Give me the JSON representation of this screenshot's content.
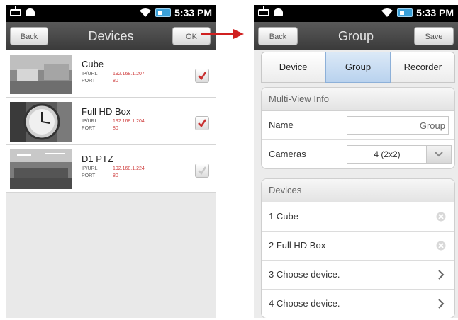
{
  "status_bar": {
    "time": "5:33 PM"
  },
  "left_screen": {
    "title": "Devices",
    "back_label": "Back",
    "ok_label": "OK",
    "devices": [
      {
        "name": "Cube",
        "ip_label": "IP/URL",
        "ip": "192.168.1.207",
        "port_label": "PORT",
        "port": "80",
        "checked": true
      },
      {
        "name": "Full HD Box",
        "ip_label": "IP/URL",
        "ip": "192.168.1.204",
        "port_label": "PORT",
        "port": "80",
        "checked": true
      },
      {
        "name": "D1 PTZ",
        "ip_label": "IP/URL",
        "ip": "192.168.1.224",
        "port_label": "PORT",
        "port": "80",
        "checked": false
      }
    ]
  },
  "right_screen": {
    "title": "Group",
    "back_label": "Back",
    "save_label": "Save",
    "tabs": [
      {
        "label": "Device",
        "active": false
      },
      {
        "label": "Group",
        "active": true
      },
      {
        "label": "Recorder",
        "active": false
      }
    ],
    "multi_view": {
      "header": "Multi-View Info",
      "name_label": "Name",
      "name_value": "Group",
      "cameras_label": "Cameras",
      "cameras_value": "4 (2x2)"
    },
    "devices_section": {
      "header": "Devices",
      "items": [
        {
          "label": "1  Cube",
          "action": "remove-icon"
        },
        {
          "label": "2  Full HD Box",
          "action": "remove-icon"
        },
        {
          "label": "3  Choose device.",
          "action": "chevron-right-icon"
        },
        {
          "label": "4  Choose device.",
          "action": "chevron-right-icon"
        }
      ]
    }
  },
  "colors": {
    "accent_red": "#d02020",
    "check_red": "#c83030",
    "tab_active": "#b9d2ee"
  }
}
